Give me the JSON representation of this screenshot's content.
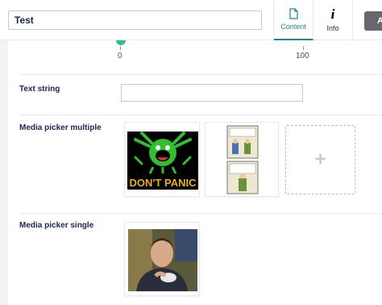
{
  "header": {
    "name_value": "Test",
    "tabs": [
      {
        "label": "Content",
        "icon": "document-icon",
        "active": true
      },
      {
        "label": "Info",
        "icon": "info-icon",
        "active": false
      }
    ],
    "actions_label": "Ac"
  },
  "slider": {
    "value": 0,
    "tick_labels": [
      "0",
      "100"
    ],
    "accent_color": "#2bc37c"
  },
  "properties": [
    {
      "label": "Text string",
      "value": ""
    },
    {
      "label": "Media picker multiple"
    },
    {
      "label": "Media picker single"
    }
  ],
  "media_multiple": {
    "items": [
      {
        "name": "dont-panic-image",
        "caption": "DON'T PANIC"
      },
      {
        "name": "comic-strip-image"
      }
    ]
  },
  "media_single": {
    "items": [
      {
        "name": "person-photo-image"
      }
    ]
  },
  "colors": {
    "accent": "#1b8a8a",
    "text": "#1b264f",
    "slider": "#2bc37c"
  }
}
